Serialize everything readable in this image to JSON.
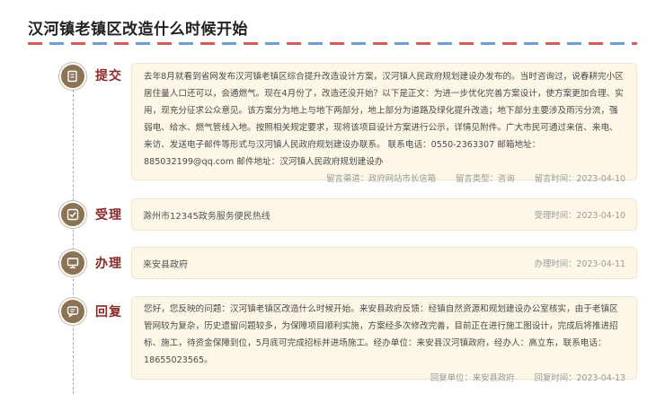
{
  "page": {
    "title": "汉河镇老镇区改造什么时候开始"
  },
  "steps": {
    "submit": {
      "label": "提交",
      "content": "去年8月就看到省网发布汉河镇老镇区综合提升改造设计方案，汉河镇人民政府规划建设办发布的。当时咨询过，说春耕完小区居住量人口还可以，会通燃气。现在4月份了，改造还没开始？以下是正文：为进一步优化完善方案设计，使方案更加合理、实用，现充分征求公众意见。该方案分为地上与地下两部分，地上部分为道路及绿化提升改造；地下部分主要涉及雨污分流，强弱电、给水、燃气管线入地。按照相关规定要求，现将该项目设计方案进行公示，详情见附件。广大市民可通过来信、来电、来访、发送电子邮件等形式与汉河镇人民政府规划建设办联系。 联系电话：0550-2363307 邮箱地址：885032199@qq.com 邮件地址：汉河镇人民政府规划建设办",
      "meta_channel": "留言渠道：政府网站市长信箱",
      "meta_type": "留言类型：咨询",
      "meta_time": "留言时间：2023-04-10"
    },
    "accept": {
      "label": "受理",
      "content": "滁州市12345政务服务便民热线",
      "time": "受理时间：2023-04-10"
    },
    "handle": {
      "label": "办理",
      "content": "来安县政府",
      "time": "办理时间：2023-04-11"
    },
    "reply": {
      "label": "回复",
      "content": "您好，您反映的问题：汉河镇老镇区改造什么时候开始。来安县政府反馈：经镇自然资源和规划建设办公室核实，由于老镇区管网较为复杂，历史遗留问题较多，为保障项目顺利实施，方案经多次修改完善，目前正在进行施工图设计，完成后将推进招标、施工，待资金保障到位，5月底可完成招标并进场施工。经办单位：来安县汉河镇政府，经办人：高立东，联系电话：18655023565。",
      "unit": "回复单位：来安县政府",
      "time": "回复时间：2023-04-13"
    }
  },
  "icons": {
    "submit": "edit-icon",
    "accept": "check-icon",
    "handle": "monitor-icon",
    "reply": "chat-icon"
  },
  "colors": {
    "icon_bg": "#8b7355",
    "label": "#8b2a2a",
    "card_bg": "#fdf7e7",
    "airmail_red": "#d95c5c",
    "airmail_blue": "#6f9bd8"
  }
}
